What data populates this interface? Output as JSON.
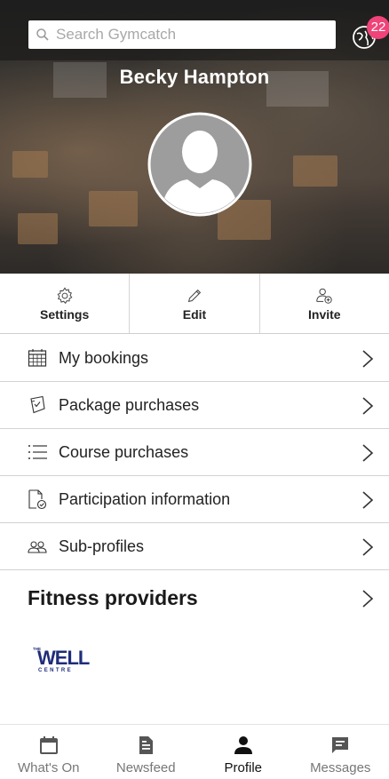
{
  "header": {
    "search_placeholder": "Search Gymcatch",
    "notification_count": "22"
  },
  "profile": {
    "name": "Becky Hampton"
  },
  "actions": {
    "settings": "Settings",
    "edit": "Edit",
    "invite": "Invite"
  },
  "menu": {
    "items": [
      {
        "label": "My bookings",
        "icon": "calendar-grid-icon"
      },
      {
        "label": "Package purchases",
        "icon": "ticket-icon"
      },
      {
        "label": "Course purchases",
        "icon": "list-icon"
      },
      {
        "label": "Participation information",
        "icon": "document-check-icon"
      },
      {
        "label": "Sub-profiles",
        "icon": "people-icon"
      }
    ]
  },
  "providers": {
    "title": "Fitness providers",
    "logo_text_main": "WELL",
    "logo_text_side": "THE",
    "logo_text_sub": "CENTRE"
  },
  "bottom_nav": {
    "items": [
      {
        "label": "What's On",
        "icon": "calendar-icon",
        "active": false
      },
      {
        "label": "Newsfeed",
        "icon": "news-icon",
        "active": false
      },
      {
        "label": "Profile",
        "icon": "person-icon",
        "active": true
      },
      {
        "label": "Messages",
        "icon": "message-icon",
        "active": false
      }
    ]
  },
  "colors": {
    "badge": "#f0437a",
    "logo_blue": "#1f2d7a"
  }
}
